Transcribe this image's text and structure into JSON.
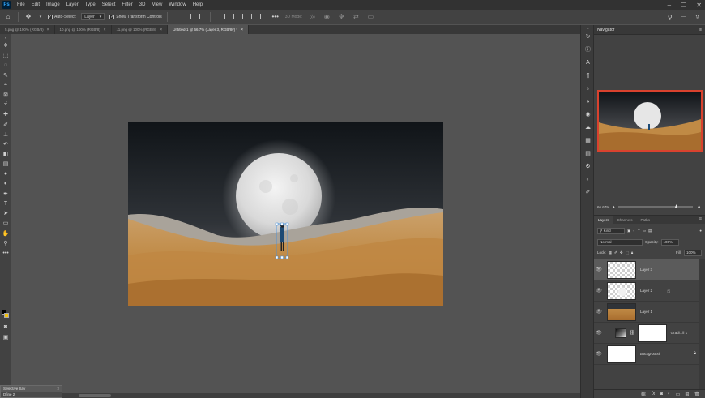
{
  "menu": {
    "items": [
      "File",
      "Edit",
      "Image",
      "Layer",
      "Type",
      "Select",
      "Filter",
      "3D",
      "View",
      "Window",
      "Help"
    ]
  },
  "options_bar": {
    "auto_select_label": "Auto-Select:",
    "auto_select_target": "Layer",
    "show_transform_label": "Show Transform Controls",
    "mode_3d_label": "3D Mode:"
  },
  "tabs": [
    {
      "label": "5.png @ 100% (RGB/8)",
      "active": false
    },
    {
      "label": "10.png @ 100% (RGB/8)",
      "active": false
    },
    {
      "label": "11.png @ 100% (RGB/8)",
      "active": false
    },
    {
      "label": "Untitled-1 @ 66.7% (Layer 3, RGB/8#) *",
      "active": true
    }
  ],
  "navigator": {
    "title": "Navigator",
    "zoom": "66.67%"
  },
  "layers_panel": {
    "tabs": [
      "Layers",
      "Channels",
      "Paths"
    ],
    "filter_kind": "Kind",
    "blend_mode": "Normal",
    "opacity_label": "Opacity:",
    "opacity_value": "100%",
    "lock_label": "Lock:",
    "fill_label": "Fill:",
    "fill_value": "100%",
    "layers": [
      {
        "name": "Layer 3",
        "selected": true
      },
      {
        "name": "Layer 2",
        "selected": false
      },
      {
        "name": "Layer 1",
        "selected": false
      },
      {
        "name": "Gradi...ll 1",
        "selected": false
      },
      {
        "name": "Background",
        "selected": false
      }
    ]
  },
  "floating_panel": {
    "title": "Selective Sav",
    "body": "Dfine 2"
  },
  "colors": {
    "foreground": "#000000",
    "background": "#f2c00b",
    "accent": "#d9422e"
  }
}
